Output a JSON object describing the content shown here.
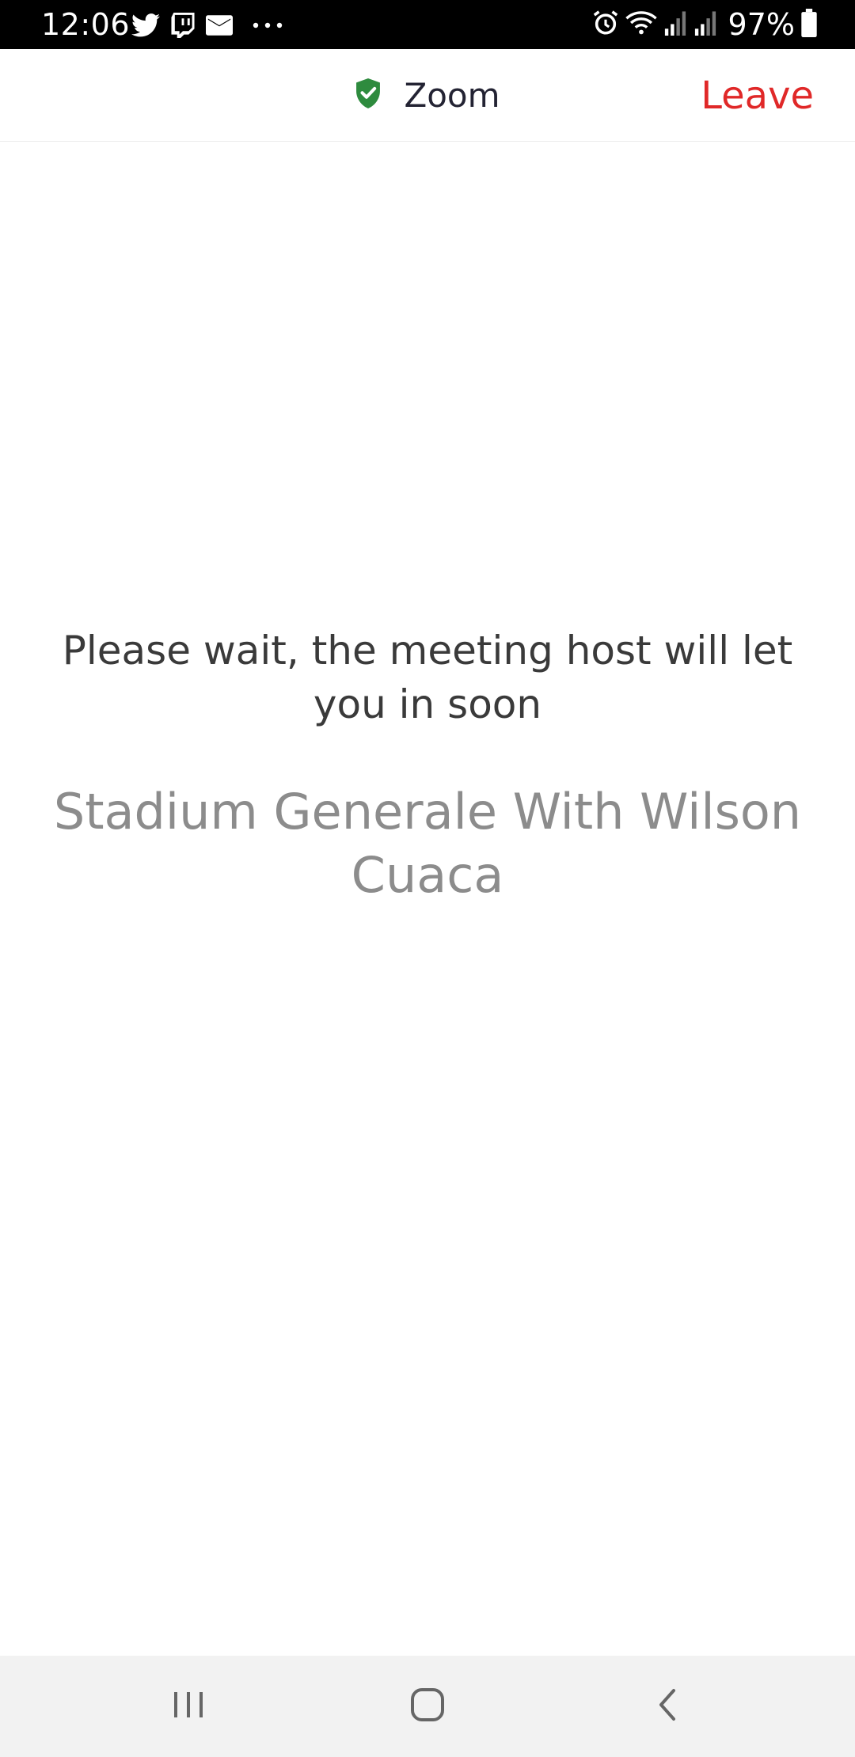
{
  "status_bar": {
    "time": "12:06",
    "notification_icons": [
      "twitter-icon",
      "twitch-icon",
      "mail-icon",
      "more-dots-icon"
    ],
    "system_icons": [
      "alarm-icon",
      "wifi-icon",
      "signal-icon",
      "signal-icon",
      "battery-icon"
    ],
    "battery_percent": "97%"
  },
  "header": {
    "title": "Zoom",
    "shield_color": "#2e8b3e",
    "leave_label": "Leave",
    "leave_color": "#e02828"
  },
  "main": {
    "wait_message": "Please wait, the meeting host will let you in soon",
    "meeting_topic": "Stadium Generale With Wilson Cuaca"
  },
  "nav_bar": {
    "buttons": [
      "recents-icon",
      "home-icon",
      "back-icon"
    ]
  }
}
